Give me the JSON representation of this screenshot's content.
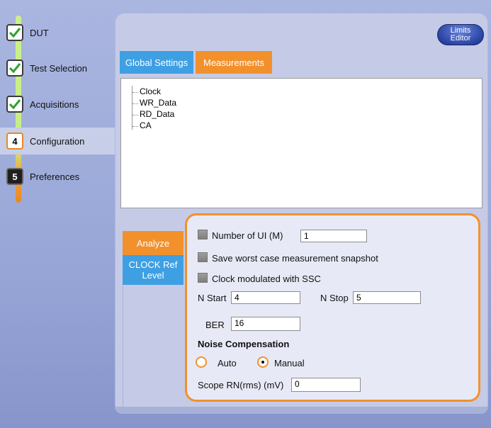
{
  "steps": [
    {
      "label": "DUT",
      "state": "done"
    },
    {
      "label": "Test Selection",
      "state": "done"
    },
    {
      "label": "Acquisitions",
      "state": "done"
    },
    {
      "label": "Configuration",
      "state": "active",
      "number": "4"
    },
    {
      "label": "Preferences",
      "state": "pending",
      "number": "5"
    }
  ],
  "limits_editor": {
    "line1": "Limits",
    "line2": "Editor"
  },
  "tabs": {
    "global": "Global Settings",
    "measurements": "Measurements",
    "active": "Measurements"
  },
  "tree": [
    "Clock",
    "WR_Data",
    "RD_Data",
    "CA"
  ],
  "tree_selected": "Clock",
  "side_tabs": {
    "analyze": "Analyze",
    "clock_ref_line1": "CLOCK Ref",
    "clock_ref_line2": "Level"
  },
  "settings": {
    "num_ui_label": "Number of UI (M)",
    "num_ui_value": "1",
    "worst_case_label": "Save worst case measurement snapshot",
    "ssc_label": "Clock modulated with SSC",
    "n_start_label": "N Start",
    "n_start_value": "4",
    "n_stop_label": "N Stop",
    "n_stop_value": "5",
    "ber_label": "BER",
    "ber_value": "16",
    "noise_header": "Noise Compensation",
    "auto_label": "Auto",
    "manual_label": "Manual",
    "noise_selected": "Manual",
    "scope_rn_label": "Scope RN(rms) (mV)",
    "scope_rn_value": "0"
  },
  "colors": {
    "accent_orange": "#f2912c",
    "accent_blue": "#3f9fe3",
    "check_green": "#2fa12f"
  }
}
